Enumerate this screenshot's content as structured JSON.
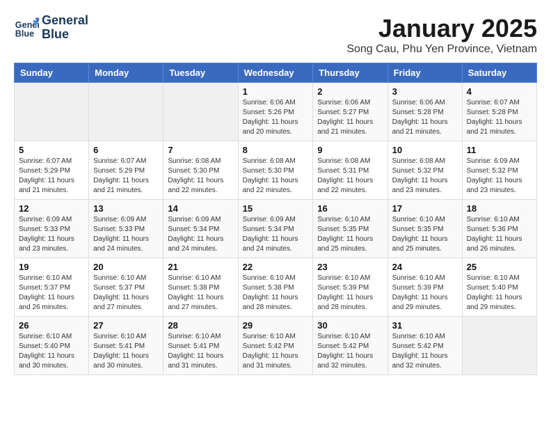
{
  "logo": {
    "line1": "General",
    "line2": "Blue"
  },
  "title": "January 2025",
  "location": "Song Cau, Phu Yen Province, Vietnam",
  "days_of_week": [
    "Sunday",
    "Monday",
    "Tuesday",
    "Wednesday",
    "Thursday",
    "Friday",
    "Saturday"
  ],
  "weeks": [
    [
      {
        "day": "",
        "info": ""
      },
      {
        "day": "",
        "info": ""
      },
      {
        "day": "",
        "info": ""
      },
      {
        "day": "1",
        "info": "Sunrise: 6:06 AM\nSunset: 5:26 PM\nDaylight: 11 hours and 20 minutes."
      },
      {
        "day": "2",
        "info": "Sunrise: 6:06 AM\nSunset: 5:27 PM\nDaylight: 11 hours and 21 minutes."
      },
      {
        "day": "3",
        "info": "Sunrise: 6:06 AM\nSunset: 5:28 PM\nDaylight: 11 hours and 21 minutes."
      },
      {
        "day": "4",
        "info": "Sunrise: 6:07 AM\nSunset: 5:28 PM\nDaylight: 11 hours and 21 minutes."
      }
    ],
    [
      {
        "day": "5",
        "info": "Sunrise: 6:07 AM\nSunset: 5:29 PM\nDaylight: 11 hours and 21 minutes."
      },
      {
        "day": "6",
        "info": "Sunrise: 6:07 AM\nSunset: 5:29 PM\nDaylight: 11 hours and 21 minutes."
      },
      {
        "day": "7",
        "info": "Sunrise: 6:08 AM\nSunset: 5:30 PM\nDaylight: 11 hours and 22 minutes."
      },
      {
        "day": "8",
        "info": "Sunrise: 6:08 AM\nSunset: 5:30 PM\nDaylight: 11 hours and 22 minutes."
      },
      {
        "day": "9",
        "info": "Sunrise: 6:08 AM\nSunset: 5:31 PM\nDaylight: 11 hours and 22 minutes."
      },
      {
        "day": "10",
        "info": "Sunrise: 6:08 AM\nSunset: 5:32 PM\nDaylight: 11 hours and 23 minutes."
      },
      {
        "day": "11",
        "info": "Sunrise: 6:09 AM\nSunset: 5:32 PM\nDaylight: 11 hours and 23 minutes."
      }
    ],
    [
      {
        "day": "12",
        "info": "Sunrise: 6:09 AM\nSunset: 5:33 PM\nDaylight: 11 hours and 23 minutes."
      },
      {
        "day": "13",
        "info": "Sunrise: 6:09 AM\nSunset: 5:33 PM\nDaylight: 11 hours and 24 minutes."
      },
      {
        "day": "14",
        "info": "Sunrise: 6:09 AM\nSunset: 5:34 PM\nDaylight: 11 hours and 24 minutes."
      },
      {
        "day": "15",
        "info": "Sunrise: 6:09 AM\nSunset: 5:34 PM\nDaylight: 11 hours and 24 minutes."
      },
      {
        "day": "16",
        "info": "Sunrise: 6:10 AM\nSunset: 5:35 PM\nDaylight: 11 hours and 25 minutes."
      },
      {
        "day": "17",
        "info": "Sunrise: 6:10 AM\nSunset: 5:35 PM\nDaylight: 11 hours and 25 minutes."
      },
      {
        "day": "18",
        "info": "Sunrise: 6:10 AM\nSunset: 5:36 PM\nDaylight: 11 hours and 26 minutes."
      }
    ],
    [
      {
        "day": "19",
        "info": "Sunrise: 6:10 AM\nSunset: 5:37 PM\nDaylight: 11 hours and 26 minutes."
      },
      {
        "day": "20",
        "info": "Sunrise: 6:10 AM\nSunset: 5:37 PM\nDaylight: 11 hours and 27 minutes."
      },
      {
        "day": "21",
        "info": "Sunrise: 6:10 AM\nSunset: 5:38 PM\nDaylight: 11 hours and 27 minutes."
      },
      {
        "day": "22",
        "info": "Sunrise: 6:10 AM\nSunset: 5:38 PM\nDaylight: 11 hours and 28 minutes."
      },
      {
        "day": "23",
        "info": "Sunrise: 6:10 AM\nSunset: 5:39 PM\nDaylight: 11 hours and 28 minutes."
      },
      {
        "day": "24",
        "info": "Sunrise: 6:10 AM\nSunset: 5:39 PM\nDaylight: 11 hours and 29 minutes."
      },
      {
        "day": "25",
        "info": "Sunrise: 6:10 AM\nSunset: 5:40 PM\nDaylight: 11 hours and 29 minutes."
      }
    ],
    [
      {
        "day": "26",
        "info": "Sunrise: 6:10 AM\nSunset: 5:40 PM\nDaylight: 11 hours and 30 minutes."
      },
      {
        "day": "27",
        "info": "Sunrise: 6:10 AM\nSunset: 5:41 PM\nDaylight: 11 hours and 30 minutes."
      },
      {
        "day": "28",
        "info": "Sunrise: 6:10 AM\nSunset: 5:41 PM\nDaylight: 11 hours and 31 minutes."
      },
      {
        "day": "29",
        "info": "Sunrise: 6:10 AM\nSunset: 5:42 PM\nDaylight: 11 hours and 31 minutes."
      },
      {
        "day": "30",
        "info": "Sunrise: 6:10 AM\nSunset: 5:42 PM\nDaylight: 11 hours and 32 minutes."
      },
      {
        "day": "31",
        "info": "Sunrise: 6:10 AM\nSunset: 5:42 PM\nDaylight: 11 hours and 32 minutes."
      },
      {
        "day": "",
        "info": ""
      }
    ]
  ]
}
